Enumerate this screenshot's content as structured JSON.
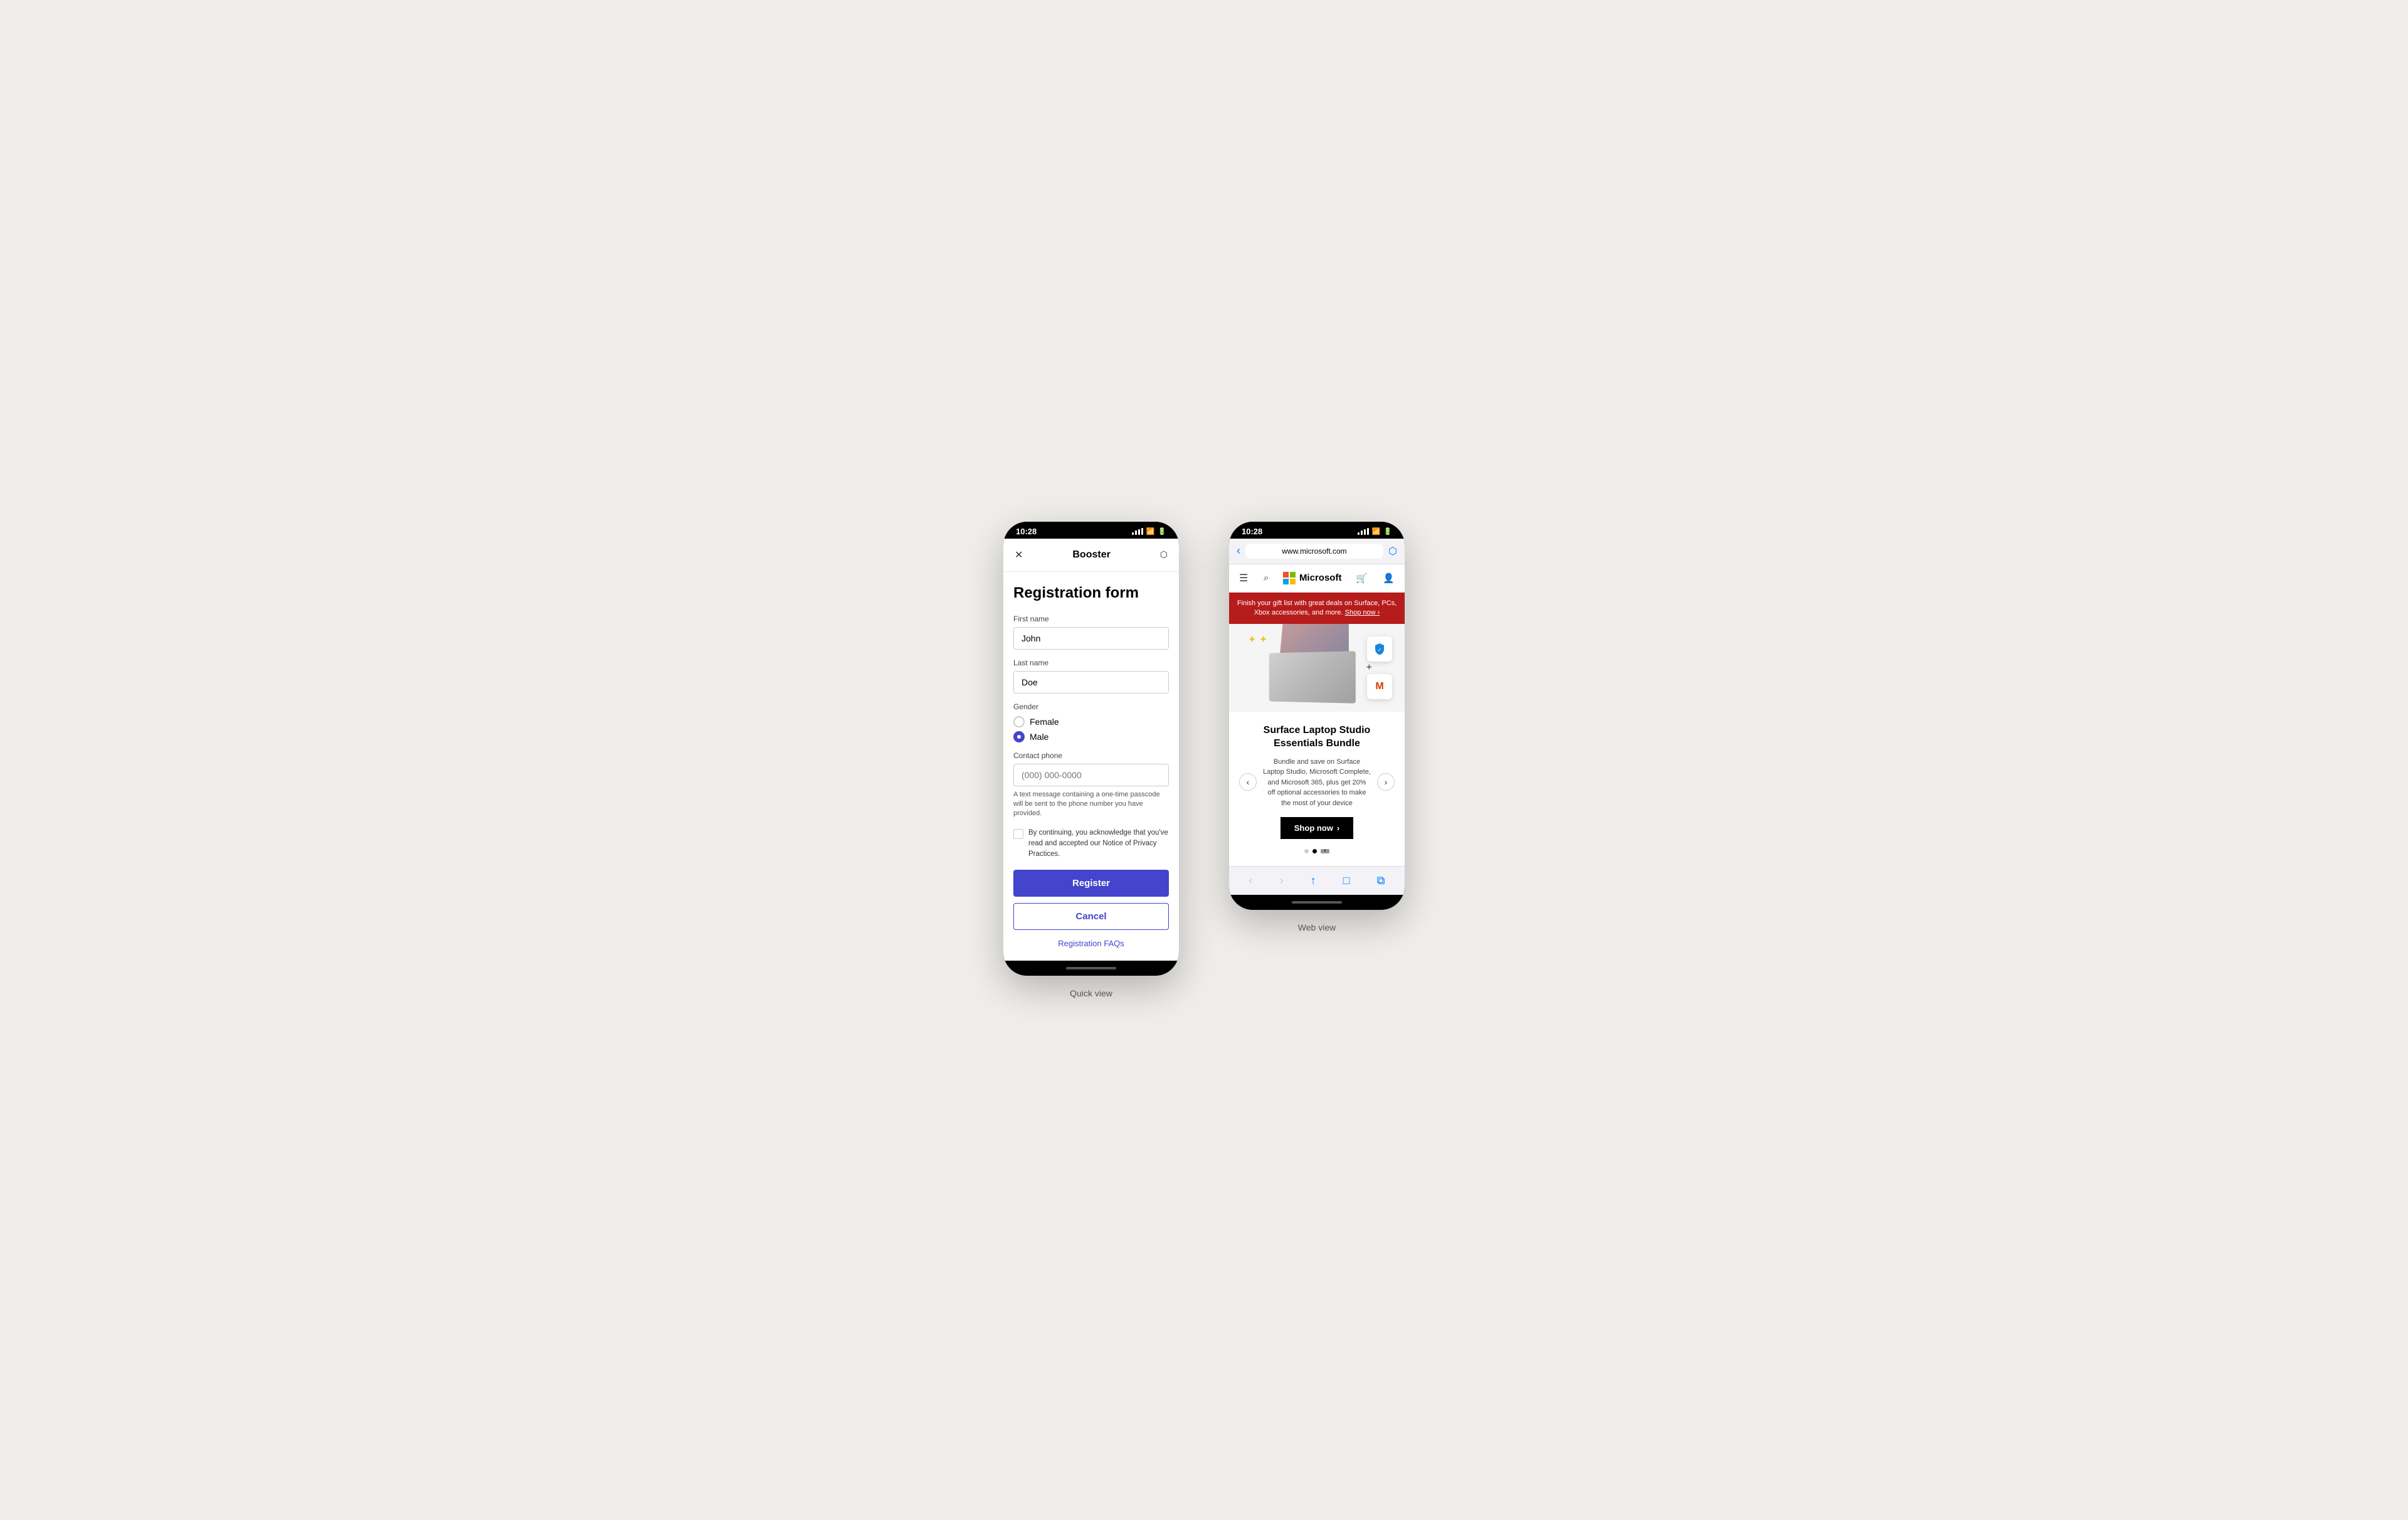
{
  "background": "#f0eeeb",
  "phone1": {
    "statusBar": {
      "time": "10:28"
    },
    "header": {
      "title": "Booster",
      "closeIcon": "✕",
      "shareIcon": "⬡"
    },
    "form": {
      "title": "Registration form",
      "firstNameLabel": "First name",
      "firstNameValue": "John",
      "lastNameLabel": "Last name",
      "lastNameValue": "Doe",
      "genderLabel": "Gender",
      "genderOptions": [
        "Female",
        "Male"
      ],
      "selectedGender": "Male",
      "contactPhoneLabel": "Contact phone",
      "contactPhonePlaceholder": "(000) 000-0000",
      "phoneHint": "A text message containing a one-time passcode will be sent to the phone number you have provided.",
      "checkboxText": "By continuing, you acknowledge that you've read and accepted our Notice of Privacy Practices.",
      "registerLabel": "Register",
      "cancelLabel": "Cancel",
      "faqLabel": "Registration FAQs"
    },
    "label": "Quick view"
  },
  "phone2": {
    "statusBar": {
      "time": "10:28"
    },
    "browser": {
      "url": "www.microsoft.com",
      "backIcon": "‹",
      "shareIcon": "⬡"
    },
    "microsoftNav": {
      "menuIcon": "☰",
      "searchIcon": "🔍",
      "brand": "Microsoft",
      "cartIcon": "🛒",
      "userIcon": "👤"
    },
    "promoBanner": {
      "text": "Finish your gift list with great deals on Surface, PCs, Xbox accessories, and more.",
      "linkText": "Shop now ›"
    },
    "carousel": {
      "title": "Surface Laptop Studio Essentials Bundle",
      "description": "Bundle and save on Surface Laptop Studio, Microsoft Complete, and Microsoft 365, plus get 20% off optional accessories to make the most of your device",
      "shopNowLabel": "Shop now",
      "dots": [
        {
          "active": false
        },
        {
          "active": true
        },
        {
          "active": false,
          "pause": true
        }
      ],
      "prevIcon": "‹",
      "nextIcon": "›"
    },
    "browserToolbar": {
      "backIcon": "‹",
      "forwardIcon": "›",
      "shareIcon": "↑",
      "bookmarkIcon": "□",
      "tabsIcon": "⧉"
    },
    "label": "Web view"
  }
}
